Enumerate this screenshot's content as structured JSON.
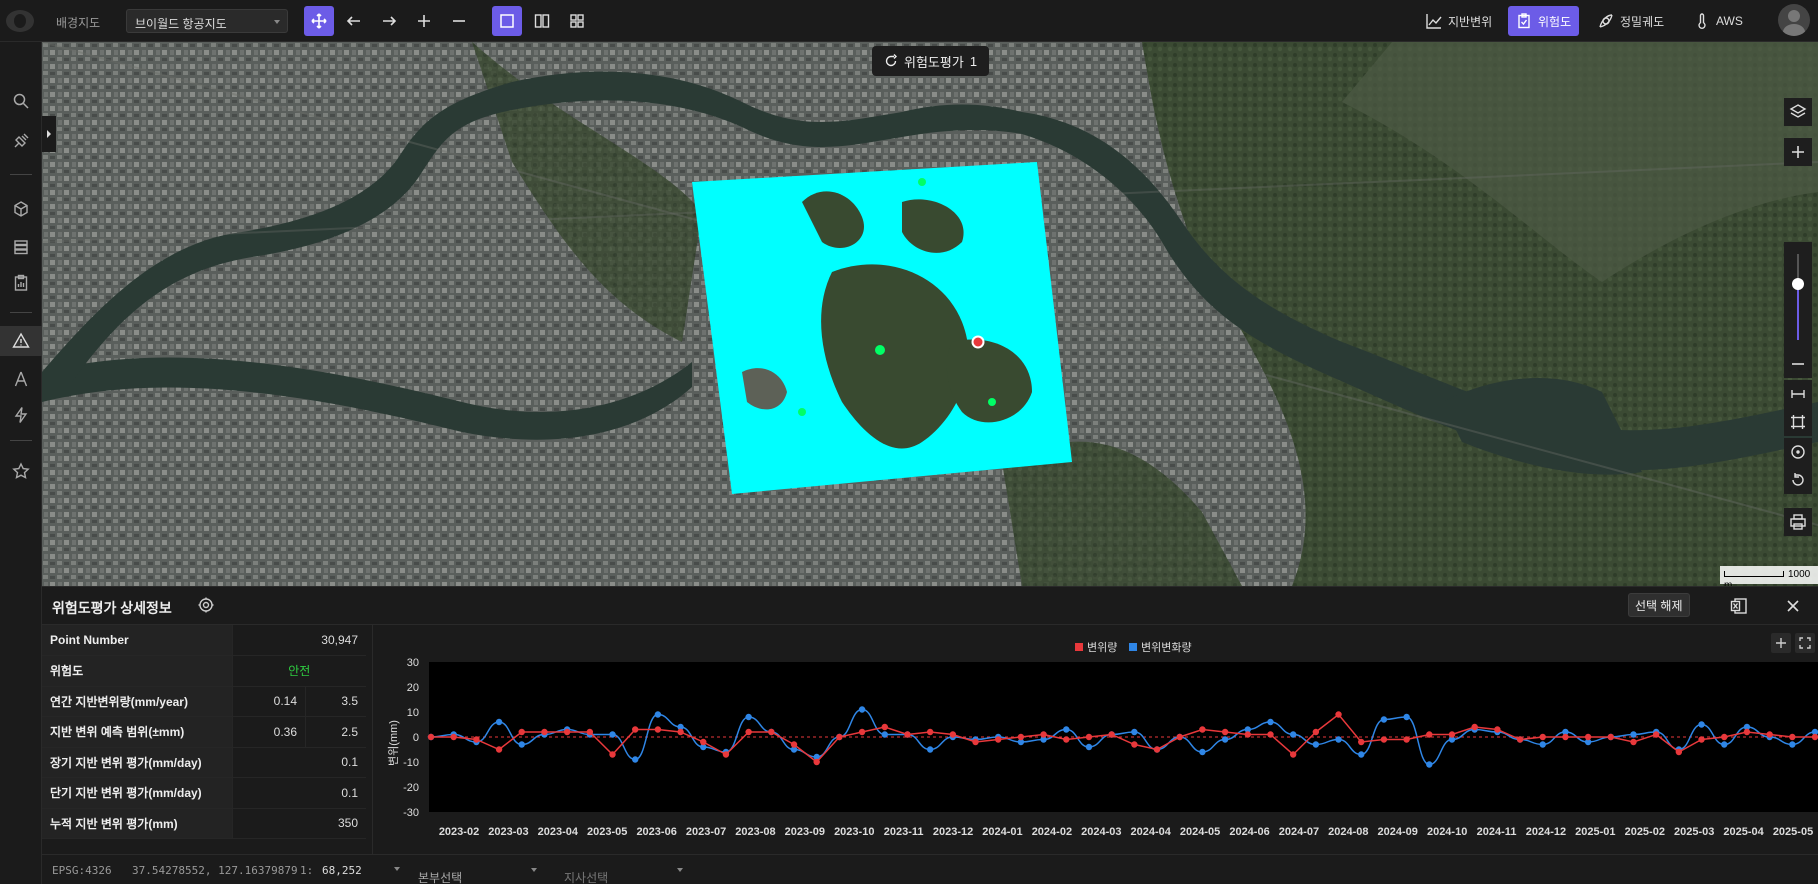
{
  "topbar": {
    "basemap_label": "배경지도",
    "basemap_value": "브이월드 항공지도",
    "right_buttons": [
      {
        "label": "지반변위",
        "icon": "line-chart-icon",
        "active": false
      },
      {
        "label": "위험도",
        "icon": "clipboard-check-icon",
        "active": true
      },
      {
        "label": "정밀궤도",
        "icon": "satellite-icon",
        "active": false
      },
      {
        "label": "AWS",
        "icon": "thermometer-icon",
        "active": false
      }
    ]
  },
  "map": {
    "chip_label": "위험도평가",
    "chip_count": "1",
    "scale_label": "1000 m"
  },
  "panel": {
    "title": "위험도평가 상세정보",
    "deselect_label": "선택 해제",
    "rows": [
      {
        "label": "Point Number",
        "v1": "30,947"
      },
      {
        "label": "위험도",
        "v1": "안전"
      },
      {
        "label": "연간 지반변위량(mm/year)",
        "v1": "0.14",
        "v2": "3.5"
      },
      {
        "label": "지반 변위 예측 범위(±mm)",
        "v1": "0.36",
        "v2": "2.5"
      },
      {
        "label": "장기 지반 변위 평가(mm/day)",
        "v1": "0.1"
      },
      {
        "label": "단기 지반 변위 평가(mm/day)",
        "v1": "0.1"
      },
      {
        "label": "누적 지반 변위 평가(mm)",
        "v1": "350"
      }
    ]
  },
  "statusbar": {
    "epsg": "EPSG:4326",
    "coords": "37.54278552, 127.16379879",
    "scale_prefix": "1:",
    "scale_value": "68,252",
    "dept_placeholder": "본부선택",
    "branch_placeholder": "지사선택"
  },
  "colors": {
    "accent": "#6c5ce7",
    "series_displacement": "#e8383b",
    "series_rate": "#2f86e6",
    "safe": "#2ecc40",
    "risk_area": "#00ffff"
  },
  "chart_data": {
    "type": "line",
    "ylabel": "변위(mm)",
    "ylim": [
      -30,
      30
    ],
    "yticks": [
      30,
      20,
      10,
      0,
      -10,
      -20,
      -30
    ],
    "x_tick_labels": [
      "2023-02",
      "2023-03",
      "2023-04",
      "2023-05",
      "2023-06",
      "2023-07",
      "2023-08",
      "2023-09",
      "2023-10",
      "2023-11",
      "2023-12",
      "2024-01",
      "2024-02",
      "2024-03",
      "2024-04",
      "2024-05",
      "2024-06",
      "2024-07",
      "2024-08",
      "2024-09",
      "2024-10",
      "2024-11",
      "2024-12",
      "2025-01",
      "2025-02",
      "2025-03",
      "2025-04",
      "2025-05"
    ],
    "legend": [
      "변위량",
      "변위변화량"
    ],
    "series": [
      {
        "name": "변위량",
        "values": [
          0,
          0,
          -1,
          -5,
          2,
          2,
          2,
          2,
          -7,
          3,
          3,
          2,
          -2,
          -7,
          2,
          2,
          -3,
          -10,
          0,
          2,
          4,
          1,
          2,
          1,
          -2,
          -1,
          0,
          1,
          -1,
          0,
          1,
          -3,
          -5,
          0,
          3,
          2,
          1,
          1,
          -7,
          2,
          9,
          -2,
          -1,
          -1,
          1,
          1,
          4,
          3,
          -1,
          0,
          0,
          0,
          0,
          -2,
          1,
          -6,
          -1,
          0,
          2,
          1,
          0,
          0
        ]
      },
      {
        "name": "변위변화량",
        "values": [
          0,
          1,
          -2,
          6,
          -3,
          1,
          3,
          1,
          1,
          -9,
          9,
          4,
          -4,
          -6,
          8,
          2,
          -5,
          -8,
          0,
          11,
          1,
          1,
          -5,
          0,
          -1,
          0,
          -2,
          -1,
          3,
          -4,
          1,
          2,
          -5,
          0,
          -6,
          -1,
          3,
          6,
          1,
          -3,
          -1,
          -7,
          7,
          8,
          -11,
          -1,
          3,
          2,
          -1,
          -3,
          2,
          -2,
          0,
          1,
          2,
          -5,
          5,
          -3,
          4,
          0,
          -3,
          2
        ]
      }
    ]
  }
}
